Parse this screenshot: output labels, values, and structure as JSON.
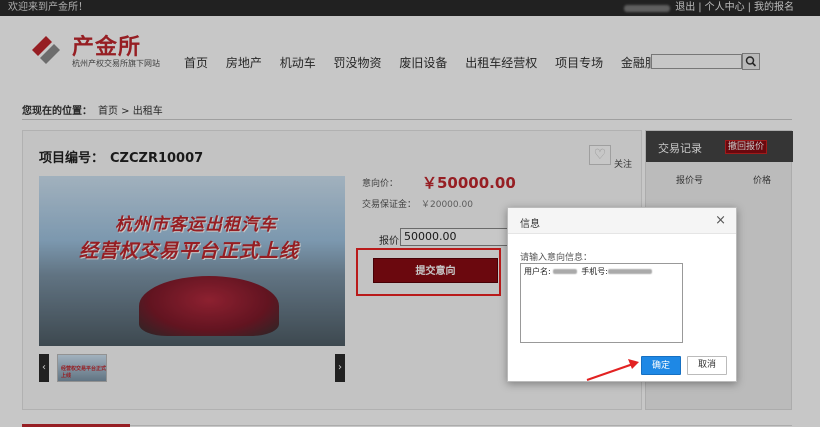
{
  "topbar": {
    "welcome": "欢迎来到产金所！",
    "links": [
      "退出",
      "个人中心",
      "我的报名"
    ]
  },
  "header": {
    "logo_title": "产金所",
    "logo_sub": "杭州产权交易所旗下网站",
    "nav": [
      "首页",
      "房地产",
      "机动车",
      "罚没物资",
      "废旧设备",
      "出租车经营权",
      "项目专场",
      "金融服务"
    ]
  },
  "breadcrumb": {
    "label": "您现在的位置：",
    "path": "首页 > 出租车"
  },
  "project": {
    "id_label": "项目编号：",
    "id_value": "CZCZR10007",
    "follow": "关注",
    "banner_line1": "杭州市客运出租汽车",
    "banner_line2": "经营权交易平台正式上线",
    "thumb_text": "经营权交易平台正式上线",
    "intent_price_label": "意向价：",
    "intent_price": "￥50000.00",
    "deposit_label": "交易保证金：",
    "deposit_value": "￥20000.00",
    "bid_label": "报价",
    "bid_value": "50000.00",
    "submit_label": "提交意向"
  },
  "side": {
    "title": "交易记录",
    "recall": "撤回报价",
    "col_quote_no": "报价号",
    "col_price": "价格"
  },
  "dialog": {
    "title": "信息",
    "prompt": "请输入意向信息：",
    "content_username_label": "用户名:",
    "content_phone_label": "手机号:",
    "ok": "确定",
    "cancel": "取消"
  },
  "colors": {
    "brand_red": "#c1272d",
    "submit_dark_red": "#8a0b13",
    "ok_blue": "#1e88e5",
    "annotation_red": "#e22222"
  }
}
